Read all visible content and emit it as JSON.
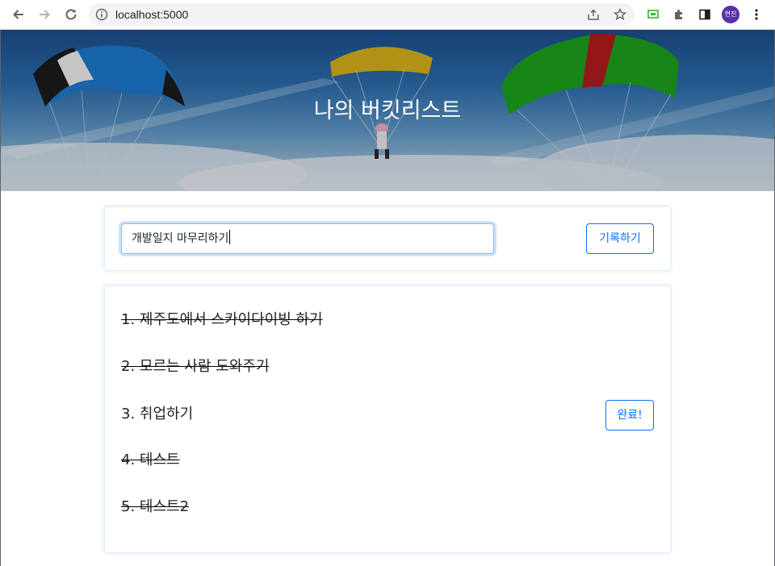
{
  "browser": {
    "url": "localhost:5000",
    "profile_initials": "현진"
  },
  "header": {
    "title": "나의 버킷리스트"
  },
  "form": {
    "input_value": "개발일지 마무리하기",
    "save_label": "기록하기"
  },
  "list": {
    "items": [
      {
        "text": "1. 제주도에서 스카이다이빙 하기",
        "done": true
      },
      {
        "text": "2. 모르는 사람 도와주기",
        "done": true
      },
      {
        "text": "3. 취업하기",
        "done": false,
        "button": "완료!"
      },
      {
        "text": "4. 테스트",
        "done": true
      },
      {
        "text": "5. 테스트2",
        "done": true
      }
    ]
  },
  "colors": {
    "accent": "#0d6efd",
    "focus_ring": "#86b7fe"
  }
}
